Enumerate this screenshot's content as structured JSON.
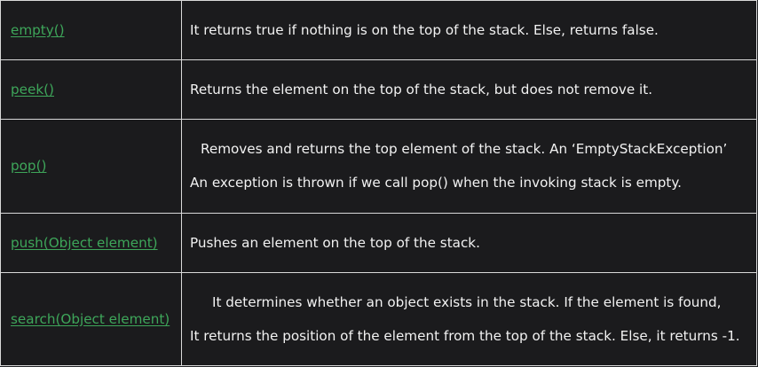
{
  "colors": {
    "background": "#1b1b1d",
    "text": "#f2f2f2",
    "link": "#3ea65a",
    "border": "#d9d9d9"
  },
  "rows": [
    {
      "method": "empty()",
      "lines": [
        "It returns true if nothing is on the top of the stack. Else, returns false."
      ]
    },
    {
      "method": "peek()",
      "lines": [
        "Returns the element on the top of the stack, but does not remove it."
      ]
    },
    {
      "method": "pop()",
      "lines": [
        "Removes and returns the top element of the stack. An ‘EmptyStackException’",
        "An exception is thrown if we call pop() when the invoking stack is empty."
      ]
    },
    {
      "method": "push(Object element)",
      "lines": [
        "Pushes an element on the top of the stack."
      ]
    },
    {
      "method": "search(Object element)",
      "lines": [
        "It determines whether an object exists in the stack. If the element is found,",
        "It returns the position of the element from the top of the stack. Else, it returns -1."
      ]
    }
  ]
}
